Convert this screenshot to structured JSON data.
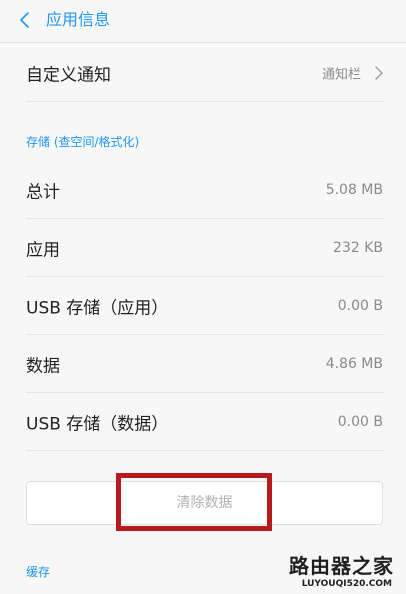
{
  "header": {
    "title": "应用信息",
    "back_icon": "chevron-left-icon"
  },
  "notification": {
    "label": "自定义通知",
    "value": "通知栏",
    "chevron_icon": "chevron-right-icon"
  },
  "storage": {
    "section_title": "存储 (查空间/格式化)",
    "rows": [
      {
        "label": "总计",
        "value": "5.08 MB"
      },
      {
        "label": "应用",
        "value": "232 KB"
      },
      {
        "label": "USB 存储（应用）",
        "value": "0.00 B"
      },
      {
        "label": "数据",
        "value": "4.86 MB"
      },
      {
        "label": "USB 存储（数据）",
        "value": "0.00 B"
      }
    ],
    "clear_button_label": "清除数据"
  },
  "cache": {
    "section_title": "缓存"
  },
  "watermark": {
    "main": "路由器之家",
    "sub": "LUYOUQI520.COM"
  },
  "colors": {
    "accent": "#2196f3",
    "highlight": "#b7191c",
    "background": "#f7f7f7"
  }
}
